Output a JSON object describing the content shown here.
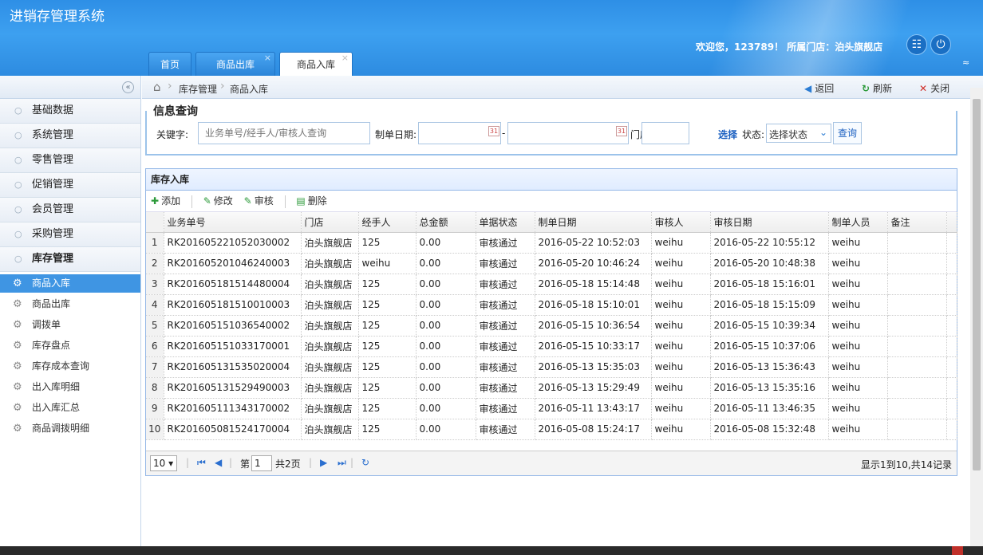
{
  "header": {
    "app_title": "进销存管理系统",
    "welcome_text": "欢迎您，123789！ 所属门店：泊头旗舰店",
    "collapse_arrows": "≈"
  },
  "tabs": [
    {
      "label": "首页"
    },
    {
      "label": "商品出库",
      "close": "×"
    },
    {
      "label": "商品入库",
      "close": "×"
    }
  ],
  "sidebar": {
    "groups": [
      {
        "label": "基础数据"
      },
      {
        "label": "系统管理"
      },
      {
        "label": "零售管理"
      },
      {
        "label": "促销管理"
      },
      {
        "label": "会员管理"
      },
      {
        "label": "采购管理"
      },
      {
        "label": "库存管理"
      }
    ],
    "items": [
      {
        "label": "商品入库"
      },
      {
        "label": "商品出库"
      },
      {
        "label": "调拨单"
      },
      {
        "label": "库存盘点"
      },
      {
        "label": "库存成本查询"
      },
      {
        "label": "出入库明细"
      },
      {
        "label": "出入库汇总"
      },
      {
        "label": "商品调拨明细"
      }
    ]
  },
  "breadcrumb": {
    "items": [
      "库存管理",
      "商品入库"
    ],
    "back": "返回",
    "refresh": "刷新",
    "close": "关闭"
  },
  "query": {
    "title": "信息查询",
    "keyword_label": "关键字:",
    "keyword_placeholder": "业务单号/经手人/审核人查询",
    "date_label": "制单日期:",
    "date_sep": "-",
    "store_label": "门店:",
    "select_link": "选择",
    "status_label": "状态:",
    "status_value": "选择状态",
    "query_button": "查询"
  },
  "grid": {
    "title": "库存入库",
    "toolbar": {
      "add": "添加",
      "edit": "修改",
      "audit": "审核",
      "delete": "删除"
    },
    "columns": [
      "业务单号",
      "门店",
      "经手人",
      "总金额",
      "单据状态",
      "制单日期",
      "审核人",
      "审核日期",
      "制单人员",
      "备注"
    ],
    "rows": [
      [
        "RK201605221052030002",
        "泊头旗舰店",
        "125",
        "0.00",
        "审核通过",
        "2016-05-22 10:52:03",
        "weihu",
        "2016-05-22 10:55:12",
        "weihu",
        ""
      ],
      [
        "RK201605201046240003",
        "泊头旗舰店",
        "weihu",
        "0.00",
        "审核通过",
        "2016-05-20 10:46:24",
        "weihu",
        "2016-05-20 10:48:38",
        "weihu",
        ""
      ],
      [
        "RK201605181514480004",
        "泊头旗舰店",
        "125",
        "0.00",
        "审核通过",
        "2016-05-18 15:14:48",
        "weihu",
        "2016-05-18 15:16:01",
        "weihu",
        ""
      ],
      [
        "RK201605181510010003",
        "泊头旗舰店",
        "125",
        "0.00",
        "审核通过",
        "2016-05-18 15:10:01",
        "weihu",
        "2016-05-18 15:15:09",
        "weihu",
        ""
      ],
      [
        "RK201605151036540002",
        "泊头旗舰店",
        "125",
        "0.00",
        "审核通过",
        "2016-05-15 10:36:54",
        "weihu",
        "2016-05-15 10:39:34",
        "weihu",
        ""
      ],
      [
        "RK201605151033170001",
        "泊头旗舰店",
        "125",
        "0.00",
        "审核通过",
        "2016-05-15 10:33:17",
        "weihu",
        "2016-05-15 10:37:06",
        "weihu",
        ""
      ],
      [
        "RK201605131535020004",
        "泊头旗舰店",
        "125",
        "0.00",
        "审核通过",
        "2016-05-13 15:35:03",
        "weihu",
        "2016-05-13 15:36:43",
        "weihu",
        ""
      ],
      [
        "RK201605131529490003",
        "泊头旗舰店",
        "125",
        "0.00",
        "审核通过",
        "2016-05-13 15:29:49",
        "weihu",
        "2016-05-13 15:35:16",
        "weihu",
        ""
      ],
      [
        "RK201605111343170002",
        "泊头旗舰店",
        "125",
        "0.00",
        "审核通过",
        "2016-05-11 13:43:17",
        "weihu",
        "2016-05-11 13:46:35",
        "weihu",
        ""
      ],
      [
        "RK201605081524170004",
        "泊头旗舰店",
        "125",
        "0.00",
        "审核通过",
        "2016-05-08 15:24:17",
        "weihu",
        "2016-05-08 15:32:48",
        "weihu",
        ""
      ]
    ],
    "pager": {
      "page_size": "10",
      "page_prefix": "第",
      "page_value": "1",
      "page_suffix": "共2页",
      "info": "显示1到10,共14记录"
    }
  },
  "colors": {
    "header_blue": "#2e8fe6",
    "active_blue": "#3f95e3",
    "link_blue": "#1a5fc0"
  }
}
